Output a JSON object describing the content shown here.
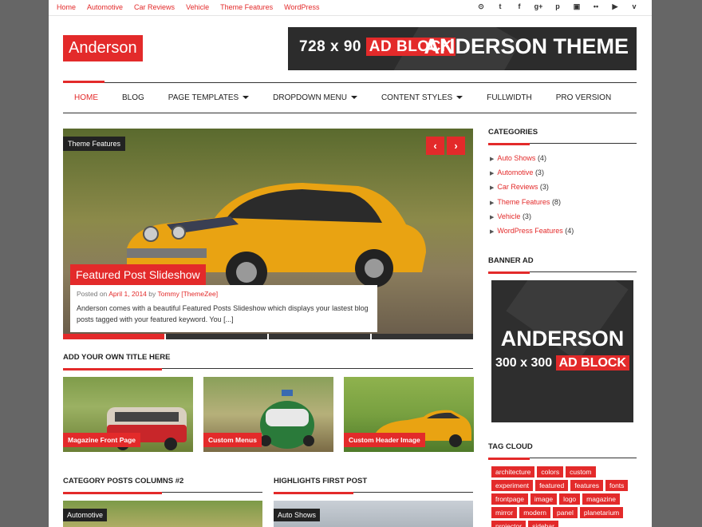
{
  "topnav": [
    "Home",
    "Automotive",
    "Car Reviews",
    "Vehicle",
    "Theme Features",
    "WordPress"
  ],
  "social_icons": [
    {
      "name": "rss-icon",
      "glyph": "⊙"
    },
    {
      "name": "twitter-icon",
      "glyph": "t"
    },
    {
      "name": "facebook-icon",
      "glyph": "f"
    },
    {
      "name": "googleplus-icon",
      "glyph": "g+"
    },
    {
      "name": "pinterest-icon",
      "glyph": "p"
    },
    {
      "name": "instagram-icon",
      "glyph": "▣"
    },
    {
      "name": "flickr-icon",
      "glyph": "••"
    },
    {
      "name": "youtube-icon",
      "glyph": "▶"
    },
    {
      "name": "vimeo-icon",
      "glyph": "v"
    }
  ],
  "site_title": "Anderson",
  "header_ad": {
    "line1_a": "728 x 90",
    "line1_b": "AD BLOCK",
    "line2": "ANDERSON THEME"
  },
  "mainnav": [
    {
      "label": "HOME",
      "active": true,
      "dropdown": false
    },
    {
      "label": "BLOG",
      "active": false,
      "dropdown": false
    },
    {
      "label": "PAGE TEMPLATES",
      "active": false,
      "dropdown": true
    },
    {
      "label": "DROPDOWN MENU",
      "active": false,
      "dropdown": true
    },
    {
      "label": "CONTENT STYLES",
      "active": false,
      "dropdown": true
    },
    {
      "label": "FULLWIDTH",
      "active": false,
      "dropdown": false
    },
    {
      "label": "PRO VERSION",
      "active": false,
      "dropdown": false
    }
  ],
  "slider": {
    "category": "Theme Features",
    "prev": "‹",
    "next": "›",
    "title": "Featured Post Slideshow",
    "posted_on": "Posted on",
    "date": "April 1, 2014",
    "by": "by",
    "author": "Tommy [ThemeZee]",
    "excerpt": "Anderson comes with a beautiful Featured Posts Slideshow which displays your lastest blog posts tagged with your featured keyword. You",
    "more": "[...]",
    "slides": 4,
    "current_slide": 1
  },
  "section1_title": "ADD YOUR OWN TITLE HERE",
  "thumbs": [
    "Magazine Front Page",
    "Custom Menus",
    "Custom Header Image"
  ],
  "section2_title": "CATEGORY POSTS COLUMNS #2",
  "section3_title": "HIGHLIGHTS FIRST POST",
  "bottom_labels": [
    "Automotive",
    "Auto Shows"
  ],
  "sidebar": {
    "categories_title": "CATEGORIES",
    "categories": [
      {
        "name": "Auto Shows",
        "count": "(4)"
      },
      {
        "name": "Automotive",
        "count": "(3)"
      },
      {
        "name": "Car Reviews",
        "count": "(3)"
      },
      {
        "name": "Theme Features",
        "count": "(8)"
      },
      {
        "name": "Vehicle",
        "count": "(3)"
      },
      {
        "name": "WordPress Features",
        "count": "(4)"
      }
    ],
    "banner_title": "BANNER AD",
    "banner": {
      "line1": "ANDERSON",
      "line2_a": "300 x 300",
      "line2_b": "AD BLOCK"
    },
    "tagcloud_title": "TAG CLOUD",
    "tags": [
      "architecture",
      "colors",
      "custom",
      "experiment",
      "featured",
      "features",
      "fonts",
      "frontpage",
      "image",
      "logo",
      "magazine",
      "mirror",
      "modern",
      "panel",
      "planetarium",
      "projector",
      "sidebar"
    ]
  },
  "colors": {
    "accent": "#e32a2a",
    "dark": "#222222",
    "page_bg": "#666666"
  }
}
